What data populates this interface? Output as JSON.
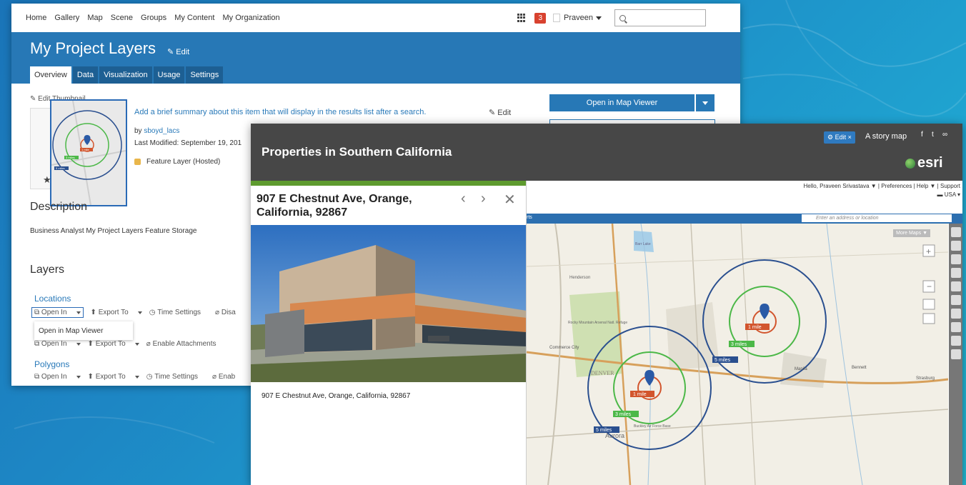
{
  "agol": {
    "nav": [
      "Home",
      "Gallery",
      "Map",
      "Scene",
      "Groups",
      "My Content",
      "My Organization"
    ],
    "notification_count": "3",
    "user_name": "Praveen",
    "title": "My Project Layers",
    "edit_label": "Edit",
    "tabs": [
      "Overview",
      "Data",
      "Visualization",
      "Usage",
      "Settings"
    ],
    "active_tab": "Overview",
    "edit_thumbnail_label": "Edit Thumbnail",
    "summary_prompt": "Add a brief summary about this item that will display in the results list after a search.",
    "summary_edit": "Edit",
    "owner_prefix": "by ",
    "owner": "sboyd_lacs",
    "last_modified": "Last Modified: September 19, 201",
    "item_type": "Feature Layer (Hosted)",
    "open_in_map_viewer": "Open in Map Viewer",
    "description_heading": "Description",
    "description_text": "Business Analyst My Project Layers Feature Storage",
    "layers_heading": "Layers",
    "layers": [
      {
        "name": "Locations",
        "tools": [
          "Open In",
          "Export To",
          "Time Settings",
          "Disa"
        ]
      },
      {
        "name": "",
        "tools": [
          "Open In",
          "Export To",
          "Enable Attachments"
        ]
      },
      {
        "name": "Polygons",
        "tools": [
          "Open In",
          "Export To",
          "Time Settings",
          "Enab"
        ]
      }
    ],
    "dropdown_item": "Open in Map Viewer",
    "thumb_labels": {
      "ring1": "1 mile",
      "ring3": "3 miles",
      "ring5": "5 miles"
    }
  },
  "story": {
    "title": "Properties in Southern California",
    "edit_chip": "Edit ×",
    "credit": "A story map",
    "brand": "esri",
    "panel_title": "907 E Chestnut Ave, Orange, California, 92867",
    "caption": "907 E Chestnut Ave, Orange, California, 92867",
    "nav_prev": "‹",
    "nav_next": "›",
    "nav_close": "✕"
  },
  "bao": {
    "greeting": "Hello, Praveen Srivastava ▼ | Preferences | Help ▼ | Support",
    "country": "USA",
    "toolbar_label": "rts",
    "search_placeholder": "Enter an address or location",
    "more_maps": "More Maps ▼",
    "ring_labels": {
      "one": "1 mile",
      "three": "3 miles",
      "five": "5 miles"
    },
    "place_labels": {
      "henderson": "Henderson",
      "commerce_city": "Commerce City",
      "aurora": "Aurora",
      "rocky_mountain": "Rocky Mountain Arsenal Natl. Refuge",
      "denver": "DENVER",
      "manila": "Manila",
      "bennett": "Bennett",
      "strasburg": "Strasburg",
      "buckley": "Buckley Air Force Base",
      "barr_lake": "Barr Lake"
    }
  }
}
